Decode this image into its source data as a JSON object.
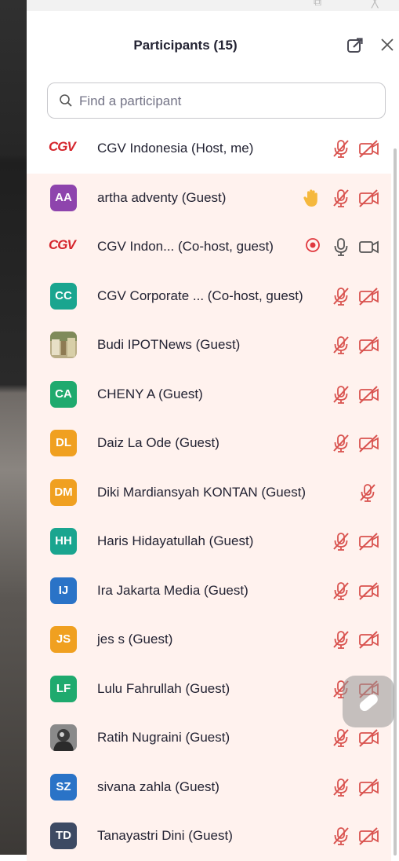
{
  "header": {
    "title": "Participants (15)"
  },
  "search": {
    "placeholder": "Find a participant"
  },
  "participants": [
    {
      "name": "CGV Indonesia (Host, me)",
      "avatar_type": "logo",
      "initials": "",
      "avatar_color": "",
      "hand_raised": false,
      "recording": false,
      "mic": "muted",
      "video": "off",
      "tinted": false
    },
    {
      "name": "artha adventy (Guest)",
      "avatar_type": "initials",
      "initials": "AA",
      "avatar_color": "#8e44ad",
      "hand_raised": true,
      "recording": false,
      "mic": "muted",
      "video": "off",
      "tinted": true
    },
    {
      "name": "CGV Indon...   (Co-host, guest)",
      "avatar_type": "logo",
      "initials": "",
      "avatar_color": "",
      "hand_raised": false,
      "recording": true,
      "mic": "on",
      "video": "on",
      "tinted": true
    },
    {
      "name": "CGV Corporate ...  (Co-host, guest)",
      "avatar_type": "initials",
      "initials": "CC",
      "avatar_color": "#1aa58f",
      "hand_raised": false,
      "recording": false,
      "mic": "muted",
      "video": "off",
      "tinted": true
    },
    {
      "name": "Budi IPOTNews (Guest)",
      "avatar_type": "photo",
      "initials": "",
      "avatar_color": "#8a8460",
      "hand_raised": false,
      "recording": false,
      "mic": "muted",
      "video": "off",
      "tinted": true
    },
    {
      "name": "CHENY A (Guest)",
      "avatar_type": "initials",
      "initials": "CA",
      "avatar_color": "#1faa6e",
      "hand_raised": false,
      "recording": false,
      "mic": "muted",
      "video": "off",
      "tinted": true
    },
    {
      "name": "Daiz La Ode (Guest)",
      "avatar_type": "initials",
      "initials": "DL",
      "avatar_color": "#f0a020",
      "hand_raised": false,
      "recording": false,
      "mic": "muted",
      "video": "off",
      "tinted": true
    },
    {
      "name": "Diki Mardiansyah KONTAN (Guest)",
      "avatar_type": "initials",
      "initials": "DM",
      "avatar_color": "#f0a020",
      "hand_raised": false,
      "recording": false,
      "mic": "muted",
      "video": "none",
      "tinted": true
    },
    {
      "name": "Haris Hidayatullah (Guest)",
      "avatar_type": "initials",
      "initials": "HH",
      "avatar_color": "#1aa58f",
      "hand_raised": false,
      "recording": false,
      "mic": "muted",
      "video": "off",
      "tinted": true
    },
    {
      "name": "Ira Jakarta Media (Guest)",
      "avatar_type": "initials",
      "initials": "IJ",
      "avatar_color": "#2a73c7",
      "hand_raised": false,
      "recording": false,
      "mic": "muted",
      "video": "off",
      "tinted": true
    },
    {
      "name": "jes s (Guest)",
      "avatar_type": "initials",
      "initials": "JS",
      "avatar_color": "#f0a020",
      "hand_raised": false,
      "recording": false,
      "mic": "muted",
      "video": "off",
      "tinted": true
    },
    {
      "name": "Lulu Fahrullah (Guest)",
      "avatar_type": "initials",
      "initials": "LF",
      "avatar_color": "#1faa6e",
      "hand_raised": false,
      "recording": false,
      "mic": "muted",
      "video": "off",
      "tinted": true
    },
    {
      "name": "Ratih Nugraini (Guest)",
      "avatar_type": "photo",
      "initials": "",
      "avatar_color": "#6b6b6b",
      "hand_raised": false,
      "recording": false,
      "mic": "muted",
      "video": "off",
      "tinted": true
    },
    {
      "name": "sivana zahla (Guest)",
      "avatar_type": "initials",
      "initials": "SZ",
      "avatar_color": "#2a73c7",
      "hand_raised": false,
      "recording": false,
      "mic": "muted",
      "video": "off",
      "tinted": true
    },
    {
      "name": "Tanayastri Dini (Guest)",
      "avatar_type": "initials",
      "initials": "TD",
      "avatar_color": "#3d4a63",
      "hand_raised": false,
      "recording": false,
      "mic": "muted",
      "video": "off",
      "tinted": true
    }
  ],
  "colors": {
    "muted_icon": "#d9534f",
    "hand": "#f5b83d",
    "accent_text": "#232333",
    "row_tint": "#fff2ee"
  }
}
